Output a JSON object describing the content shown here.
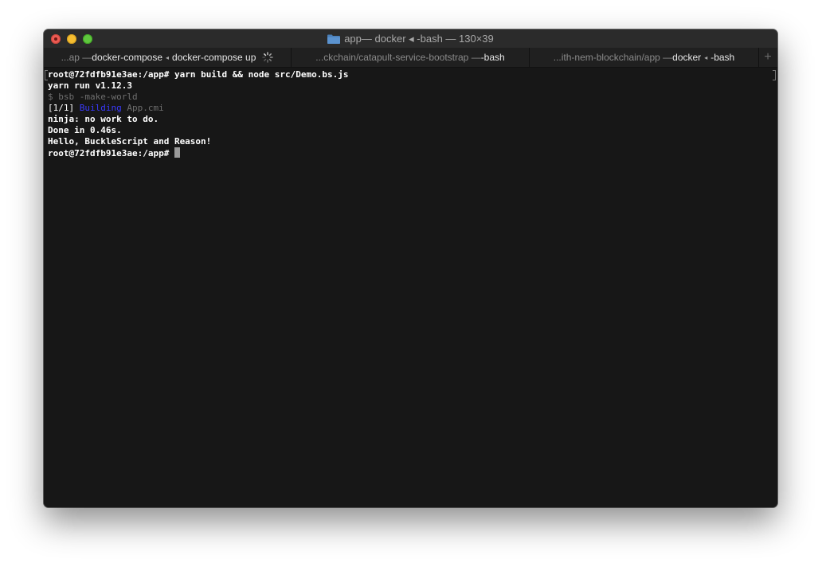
{
  "window": {
    "title_main": "app",
    "title_rest": " — docker ◂ -bash — 130×39"
  },
  "tabs": [
    {
      "prefix": "...ap — ",
      "strong": "docker-compose",
      "sep": "◂",
      "strong2": "docker-compose up"
    },
    {
      "prefix": "...ckchain/catapult-service-bootstrap — ",
      "strong": "-bash"
    },
    {
      "prefix": "...ith-nem-blockchain/app — ",
      "strong": "docker",
      "sep": "◂",
      "strong2": "-bash"
    }
  ],
  "new_tab_label": "+",
  "terminal": {
    "line1_prompt": "root@72fdfb91e3ae:/app# ",
    "line1_cmd": "yarn build && node src/Demo.bs.js",
    "line2": "yarn run v1.12.3",
    "line3": "$ bsb -make-world",
    "line4_a": "[1/1] ",
    "line4_b": "Building",
    "line4_c": " App.cmi",
    "line5": "ninja: no work to do.",
    "line6": "Done in 0.46s.",
    "line7": "Hello, BuckleScript and Reason!",
    "line8_prompt": "root@72fdfb91e3ae:/app# "
  },
  "colors": {
    "terminal_bg": "#171717",
    "text": "#ffffff",
    "dim_text": "#6f6f6f",
    "building": "#3a3aff",
    "close": "#ed5b53",
    "minimize": "#f5bd30",
    "zoom": "#5fc73e"
  },
  "icons": [
    "folder-icon",
    "spinner-icon",
    "plus-icon"
  ]
}
